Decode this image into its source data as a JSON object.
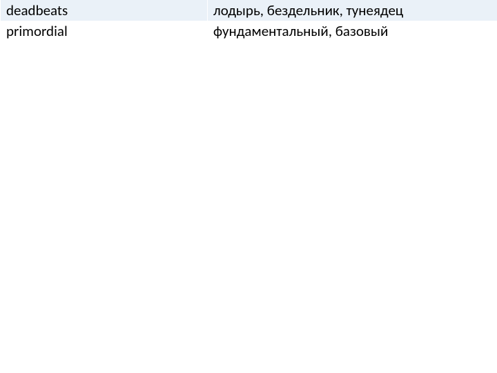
{
  "rows": [
    {
      "en": "deadbeats",
      "ru": "лодырь, бездельник, тунеядец"
    },
    {
      "en": "primordial",
      "ru": "фундаментальный, базовый"
    }
  ]
}
